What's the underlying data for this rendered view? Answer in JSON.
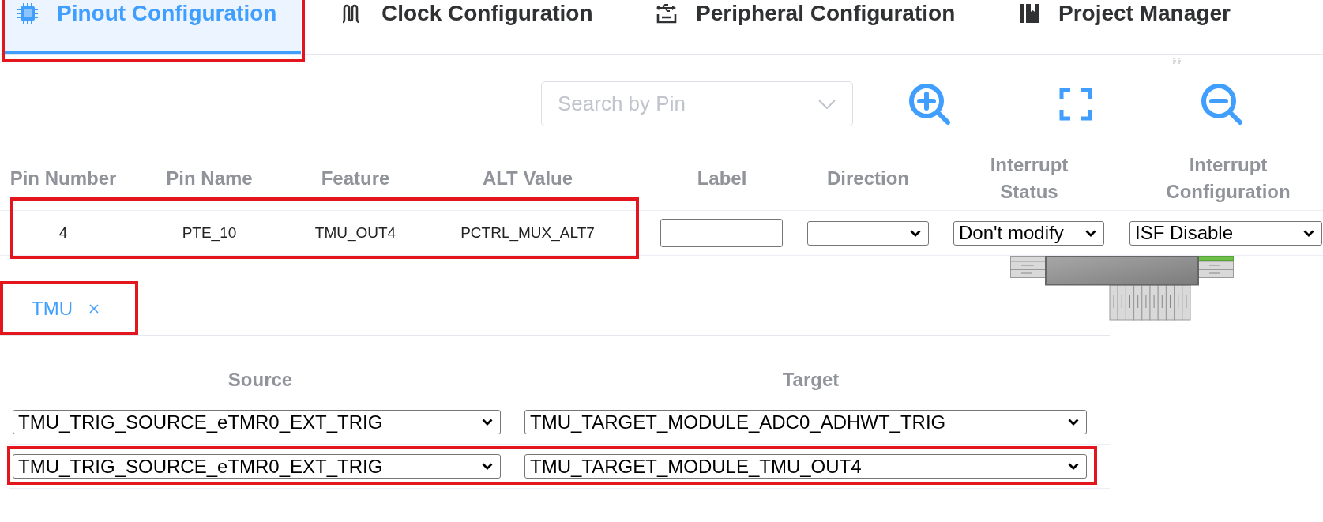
{
  "tabs": [
    {
      "label": "Pinout Configuration",
      "selected": true,
      "highlighted": true
    },
    {
      "label": "Clock Configuration",
      "selected": false,
      "highlighted": false
    },
    {
      "label": "Peripheral Configuration",
      "selected": false,
      "highlighted": false
    },
    {
      "label": "Project Manager",
      "selected": false,
      "highlighted": false
    }
  ],
  "search": {
    "placeholder": "Search by Pin"
  },
  "pin_table": {
    "columns": [
      "Pin Number",
      "Pin Name",
      "Feature",
      "ALT Value",
      "Label",
      "Direction",
      "Interrupt Status",
      "Interrupt Configuration"
    ],
    "rows": [
      {
        "highlighted": true,
        "pin_number": "4",
        "pin_name": "PTE_10",
        "feature": "TMU_OUT4",
        "alt_value": "PCTRL_MUX_ALT7",
        "interrupt_status": "Don't modify",
        "interrupt_configuration": "ISF Disable"
      }
    ]
  },
  "module_tabs": [
    {
      "label": "TMU",
      "selected": true,
      "highlighted": true
    }
  ],
  "trigger_table": {
    "columns": [
      "Source",
      "Target"
    ],
    "rows": [
      {
        "source": "TMU_TRIG_SOURCE_eTMR0_EXT_TRIG",
        "target": "TMU_TARGET_MODULE_ADC0_ADHWT_TRIG",
        "highlighted": false
      },
      {
        "source": "TMU_TRIG_SOURCE_eTMR0_EXT_TRIG",
        "target": "TMU_TARGET_MODULE_TMU_OUT4",
        "highlighted": true
      }
    ]
  }
}
